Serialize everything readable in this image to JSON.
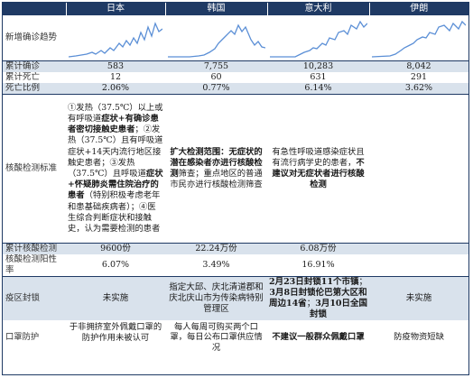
{
  "header": {
    "col1": "",
    "countries": [
      "日本",
      "韩国",
      "意大利",
      "伊朗"
    ]
  },
  "rows": {
    "trend_label": "新增确诊趋势",
    "confirmed_label": "累计确诊",
    "confirmed": [
      "583",
      "7,755",
      "10,283",
      "8,042"
    ],
    "deaths_label": "累计死亡",
    "deaths": [
      "12",
      "60",
      "631",
      "291"
    ],
    "ratio_label": "死亡比例",
    "ratio": [
      "2.06%",
      "0.77%",
      "6.14%",
      "3.62%"
    ],
    "standard_label": "核酸检测标准",
    "tests_label": "累计核酸检测",
    "tests": [
      "9600份",
      "22.24万份",
      "6.08万份",
      ""
    ],
    "positive_label": "核酸检测阳性率",
    "positive": [
      "6.07%",
      "3.49%",
      "16.91%",
      ""
    ],
    "lockdown_label": "疫区封锁",
    "mask_label": "口罩防护"
  },
  "standard": {
    "japan": [
      {
        "t": "①发热（37.5℃）以上或有呼吸道",
        "b": false
      },
      {
        "t": "症状+有确诊患者密切接触史患者",
        "b": true
      },
      {
        "t": "；②发热（37.5℃）且有呼吸道症状+14天内流行地区接触史患者；③发热（37.5℃）且呼吸道",
        "b": false
      },
      {
        "t": "症状+怀疑肺炎需住院治疗的患者",
        "b": true
      },
      {
        "t": "（特别积极考虑老年和患基础疾病者）；④医生综合判断症状和接触史，认为需要检测的患者",
        "b": false
      }
    ],
    "korea": [
      {
        "t": "扩大检测范围：无症状的潜在感染者亦进行核酸检测",
        "b": true
      },
      {
        "t": "筛查；重点地区的普通市民亦进行核酸检测筛查",
        "b": false
      }
    ],
    "italy": [
      {
        "t": "有急性呼吸道感染症状且有流行病学史的患者，",
        "b": false
      },
      {
        "t": "不建议对无症状者进行核酸检测",
        "b": true
      }
    ]
  },
  "lockdown": {
    "japan": "未实施",
    "korea": "指定大邱、庆北清道郡和庆北庆山市为传染病特别管理区",
    "italy_parts": [
      {
        "t": "2月23日封锁11个市镇",
        "b": true
      },
      {
        "t": "；",
        "b": false
      },
      {
        "t": "3月8日封锁伦巴第大区和周边14省",
        "b": true
      },
      {
        "t": "；",
        "b": false
      },
      {
        "t": "3月10日全国封锁",
        "b": true
      }
    ],
    "iran": "未实施"
  },
  "mask": {
    "japan": "于非拥挤室外佩戴口罩的防护作用未被认可",
    "korea": "每人每周可购买两个口罩，每日公布口罩供应情况",
    "italy": "不建议一般群众佩戴口罩",
    "iran": "防疫物资短缺"
  },
  "colors": {
    "header": "#1f3a64",
    "shade": "#d9e2ec",
    "spark": "#5b8fd6"
  }
}
